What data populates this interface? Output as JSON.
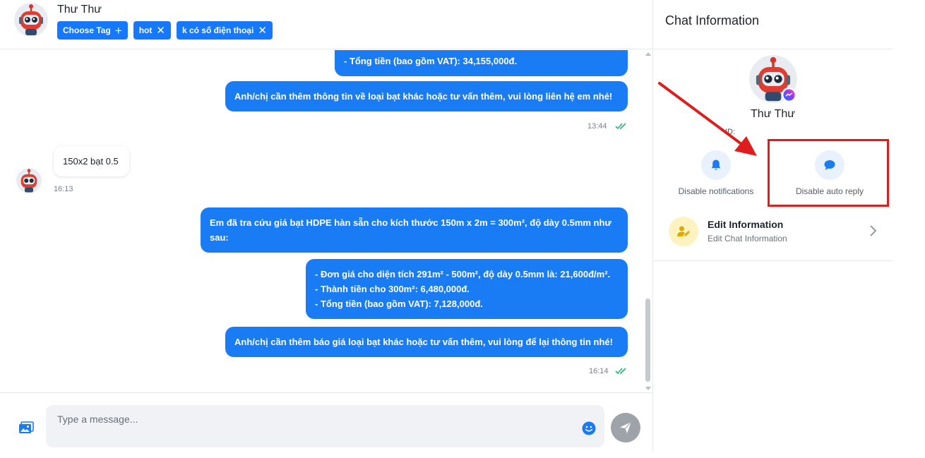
{
  "header": {
    "contact_name": "Thư Thư",
    "choose_tag_label": "Choose Tag",
    "tags": [
      {
        "label": "hot"
      },
      {
        "label": "k có số điện thoại"
      }
    ]
  },
  "messages": [
    {
      "direction": "out",
      "lines": [
        "- Tổng tiền (bao gồm VAT): 34,155,000đ."
      ]
    },
    {
      "direction": "out",
      "lines": [
        "Anh/chị cần thêm thông tin về loại bạt khác hoặc tư vấn thêm, vui lòng liên hệ em nhé!"
      ],
      "time": "13:44"
    },
    {
      "direction": "in",
      "lines": [
        "150x2 bạt 0.5"
      ],
      "time": "16:13"
    },
    {
      "direction": "out",
      "lines": [
        "Em đã tra cứu giá bạt HDPE hàn sẵn cho kích thước 150m x 2m = 300m², độ dày 0.5mm như",
        "sau:"
      ]
    },
    {
      "direction": "out",
      "lines": [
        "- Đơn giá cho diện tích 291m² - 500m², độ dày 0.5mm là: 21,600đ/m².",
        "- Thành tiền cho 300m²: 6,480,000đ.",
        "- Tổng tiền (bao gồm VAT): 7,128,000đ."
      ]
    },
    {
      "direction": "out",
      "lines": [
        "Anh/chị cần thêm báo giá loại bạt khác hoặc tư vấn thêm, vui lòng để lại thông tin nhé!"
      ],
      "time": "16:14"
    }
  ],
  "composer": {
    "placeholder": "Type a message..."
  },
  "info_panel": {
    "title": "Chat Information",
    "profile_name": "Thư Thư",
    "uid_label": "ID:",
    "actions": [
      {
        "label": "Disable notifications",
        "icon": "bell-icon"
      },
      {
        "label": "Disable auto reply",
        "icon": "chat-bubble-icon"
      }
    ],
    "edit": {
      "title": "Edit Information",
      "subtitle": "Edit Chat Information"
    }
  },
  "colors": {
    "accent": "#1677ff",
    "outgoing_bubble": "#1a7cf5",
    "highlight": "#e01d1d",
    "read_tick": "#22b573"
  }
}
